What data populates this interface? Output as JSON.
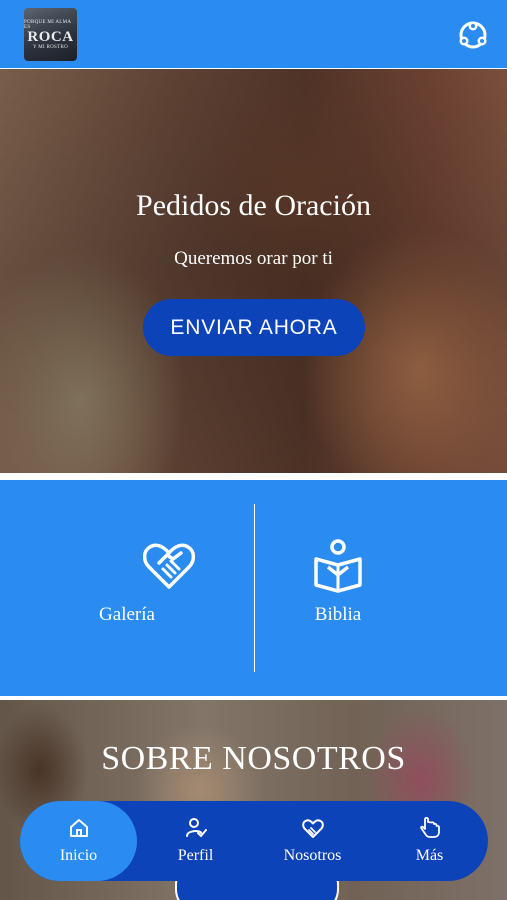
{
  "header": {
    "logo": {
      "line1": "PORQUE MI ALMA ES",
      "line2": "ROCA",
      "line3": "Y MI ROSTRO"
    },
    "menu_icon": "people-circle-icon"
  },
  "hero": {
    "title": "Pedidos de Oración",
    "subtitle": "Queremos orar por ti",
    "button_label": "ENVIAR AHORA"
  },
  "tiles": [
    {
      "label": "Galería",
      "icon": "handshake-heart-icon"
    },
    {
      "label": "Biblia",
      "icon": "person-reading-icon"
    }
  ],
  "about": {
    "title": "SOBRE NOSOTROS"
  },
  "bottom_nav": {
    "items": [
      {
        "label": "Inicio",
        "icon": "home-icon",
        "active": true
      },
      {
        "label": "Perfil",
        "icon": "person-check-icon",
        "active": false
      },
      {
        "label": "Nosotros",
        "icon": "handshake-heart-icon",
        "active": false
      },
      {
        "label": "Más",
        "icon": "hand-pointer-icon",
        "active": false
      }
    ]
  },
  "colors": {
    "primary": "#2a8cf0",
    "accent": "#0c43b8",
    "text": "#ffffff"
  }
}
